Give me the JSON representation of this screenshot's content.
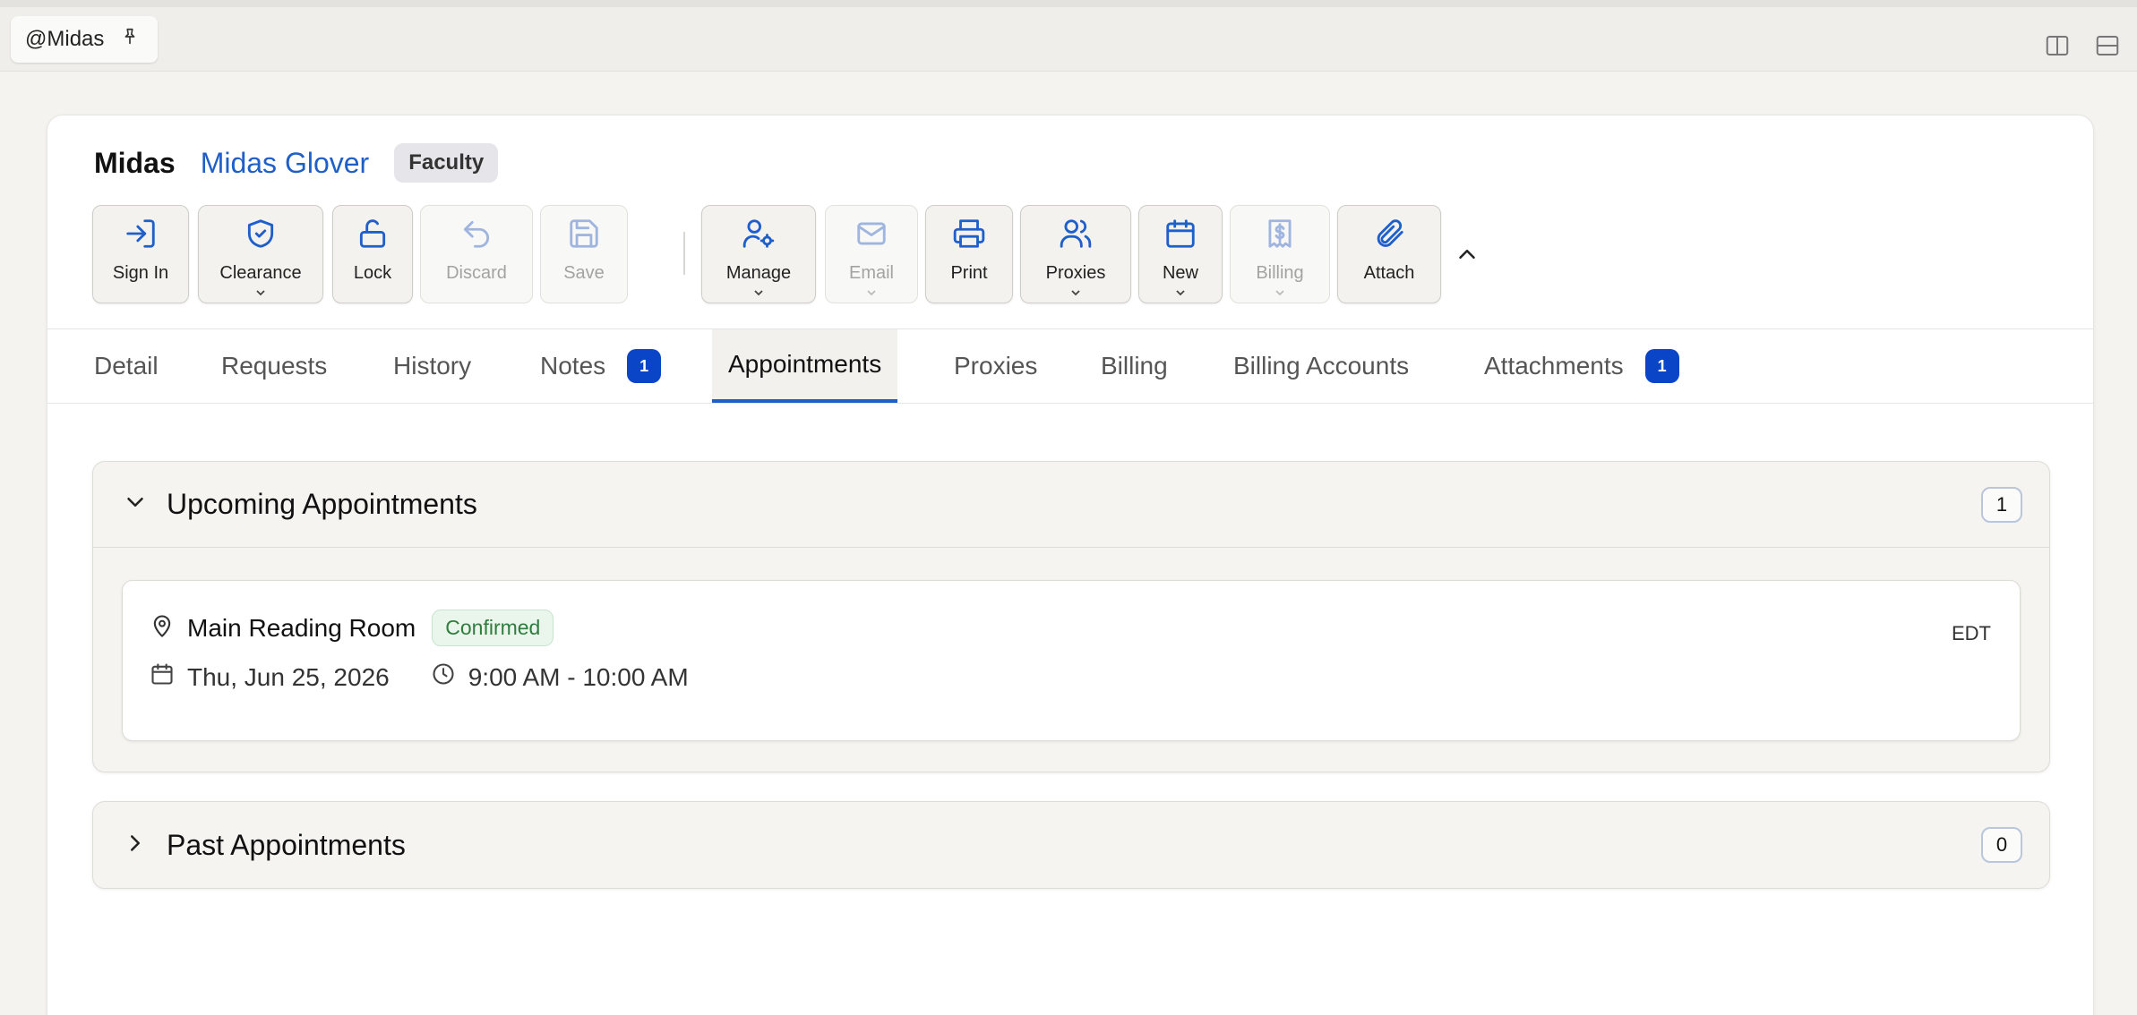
{
  "window": {
    "tab_label": "@Midas",
    "icons": [
      "pin-icon",
      "split-vertical-icon",
      "split-horizontal-icon"
    ]
  },
  "header": {
    "short_name": "Midas",
    "full_name": "Midas Glover",
    "role_badge": "Faculty"
  },
  "toolbar": {
    "sign_in": "Sign In",
    "clearance": "Clearance",
    "lock": "Lock",
    "discard": "Discard",
    "save": "Save",
    "manage": "Manage",
    "email": "Email",
    "print": "Print",
    "proxies": "Proxies",
    "new": "New",
    "billing": "Billing",
    "attach": "Attach"
  },
  "tabs": {
    "detail": "Detail",
    "requests": "Requests",
    "history": "History",
    "notes": "Notes",
    "notes_count": "1",
    "appointments": "Appointments",
    "proxies": "Proxies",
    "billing": "Billing",
    "billing_accounts": "Billing Accounts",
    "attachments": "Attachments",
    "attachments_count": "1"
  },
  "upcoming": {
    "title": "Upcoming Appointments",
    "count": "1",
    "appointment": {
      "location": "Main Reading Room",
      "status": "Confirmed",
      "date": "Thu, Jun 25, 2026",
      "time": "9:00 AM - 10:00 AM",
      "timezone": "EDT"
    }
  },
  "past": {
    "title": "Past Appointments",
    "count": "0"
  },
  "colors": {
    "accent": "#1f5fc9",
    "badge_blue": "#0b45c7",
    "confirmed_green": "#2f7d3d"
  }
}
